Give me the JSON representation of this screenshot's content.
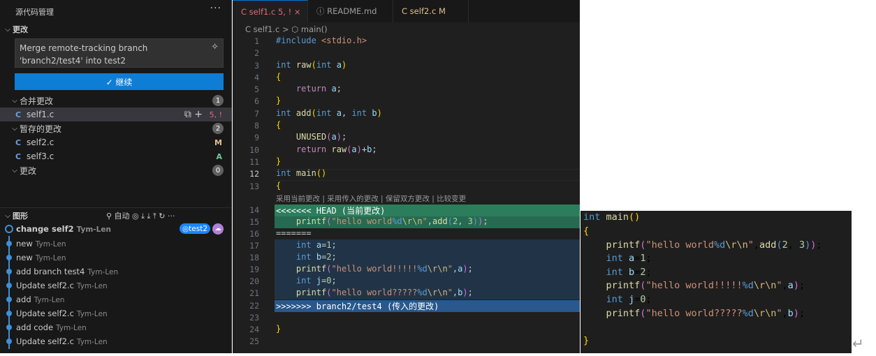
{
  "sidebar": {
    "title": "源代码管理",
    "more": "···",
    "changes_header": "更改",
    "commit_message": "Merge remote-tracking branch 'branch2/test4' into test2",
    "sparkle": "✧",
    "commit_button": "✓ 继续",
    "groups": [
      {
        "label": "合并更改",
        "count": "1"
      },
      {
        "label": "暂存的更改",
        "count": "2"
      },
      {
        "label": "更改",
        "count": "0"
      }
    ],
    "files": [
      {
        "icon": "C",
        "name": "self1.c",
        "status": "5, !"
      },
      {
        "icon": "C",
        "name": "self2.c",
        "status": "M"
      },
      {
        "icon": "C",
        "name": "self3.c",
        "status": "A"
      }
    ],
    "file_actions": "⧉ +",
    "graph_header": "图形",
    "graph_tools": "⚲ 自动 ◎ ⤓ ⤓ ⤒ ↻ ···",
    "graph_items": [
      {
        "title": "change self2",
        "author": "Tym-Len"
      },
      {
        "title": "new",
        "author": "Tym-Len"
      },
      {
        "title": "new",
        "author": "Tym-Len"
      },
      {
        "title": "add branch test4",
        "author": "Tym-Len"
      },
      {
        "title": "Update self2.c",
        "author": "Tym-Len"
      },
      {
        "title": "add",
        "author": "Tym-Len"
      },
      {
        "title": "Update self2.c",
        "author": "Tym-Len"
      },
      {
        "title": "add code",
        "author": "Tym-Len"
      },
      {
        "title": "Update self2.c",
        "author": "Tym-Len"
      }
    ],
    "graph_tag": "◎test2",
    "graph_cloud": "☁"
  },
  "tabs": [
    {
      "label": "C  self1.c  5, !  ×"
    },
    {
      "label": "ⓘ  README.md"
    },
    {
      "label": "C  self2.c   M"
    }
  ],
  "breadcrumb": "C  self1.c  >  ⬡ main()",
  "codelens": "采用当前更改 | 采用传入的更改 | 保留双方更改 | 比较变更",
  "line_numbers": [
    "1",
    "2",
    "3",
    "4",
    "5",
    "6",
    "7",
    "8",
    "9",
    "10",
    "11",
    "12",
    "13",
    "14",
    "15",
    "16",
    "17",
    "18",
    "19",
    "20",
    "21",
    "22",
    "23",
    "24",
    "25"
  ],
  "conflict": {
    "current_marker": "<<<<<<< HEAD (当前更改)",
    "separator": "=======",
    "incoming_marker": ">>>>>>> branch2/test4 (传入的更改)"
  },
  "return_symbol": "↵"
}
